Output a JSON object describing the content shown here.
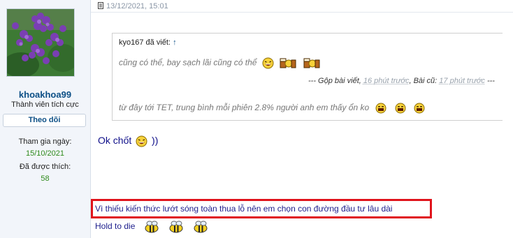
{
  "user": {
    "username": "khoakhoa99",
    "title": "Thành viên tích cực",
    "follow_label": "Theo dõi",
    "joined_label": "Tham gia ngày:",
    "joined_value": "15/10/2021",
    "likes_label": "Đã được thích:",
    "likes_value": "58"
  },
  "post": {
    "date": "13/12/2021, 15:01",
    "quote": {
      "author": "kyo167 đã viết:",
      "link_arrow": "↑",
      "line1": "cũng có thể, bay sạch lãi cũng có thể",
      "merge_prefix": "--- Gộp bài viết,",
      "merge_time1": "16 phút trước",
      "merge_mid": ", Bài cũ:",
      "merge_time2": "17 phút trước",
      "merge_suffix": "---",
      "line2": "từ đây tới TET, trung bình mỗi phiên 2.8% người anh em thấy ổn ko"
    },
    "reply_text": "Ok chốt",
    "reply_suffix": "))"
  },
  "signature": {
    "line1": "Vì thiếu kiến thức lướt sóng toàn thua lỗ nên em chọn con đường đầu tư lâu dài",
    "line2": "Hold to die"
  }
}
